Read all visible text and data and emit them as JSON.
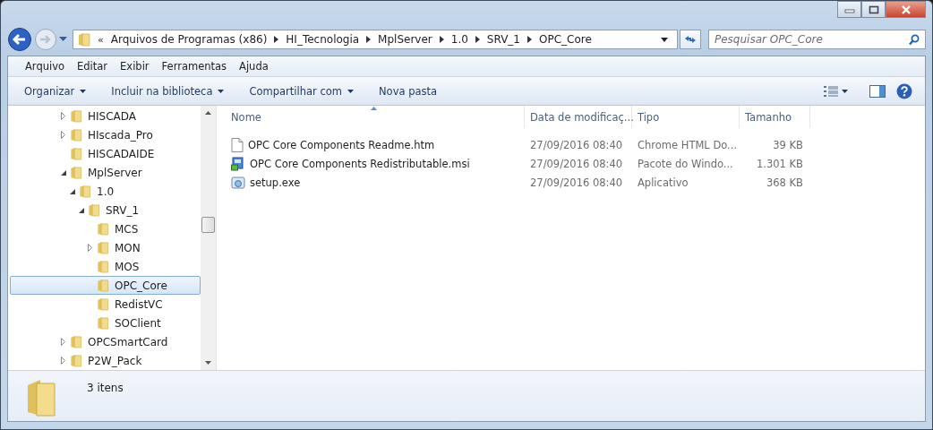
{
  "address_bar": {
    "overflow": "«",
    "path": [
      "Arquivos de Programas (x86)",
      "HI_Tecnologia",
      "MplServer",
      "1.0",
      "SRV_1",
      "OPC_Core"
    ]
  },
  "search": {
    "placeholder": "Pesquisar OPC_Core"
  },
  "menu": [
    "Arquivo",
    "Editar",
    "Exibir",
    "Ferramentas",
    "Ajuda"
  ],
  "commands": [
    {
      "label": "Organizar",
      "dropdown": true
    },
    {
      "label": "Incluir na biblioteca",
      "dropdown": true
    },
    {
      "label": "Compartilhar com",
      "dropdown": true
    },
    {
      "label": "Nova pasta",
      "dropdown": false
    }
  ],
  "tree": [
    {
      "label": "HISCADA",
      "kind": "collapsed",
      "selected": false
    },
    {
      "label": "HIscada_Pro",
      "kind": "collapsed",
      "selected": false
    },
    {
      "label": "HISCADAIDE",
      "kind": "leaf",
      "selected": false
    },
    {
      "label": "MplServer",
      "kind": "expanded",
      "selected": false,
      "children": [
        {
          "label": "1.0",
          "kind": "expanded",
          "selected": false,
          "children": [
            {
              "label": "SRV_1",
              "kind": "expanded",
              "selected": false,
              "children": [
                {
                  "label": "MCS",
                  "kind": "leaf",
                  "selected": false
                },
                {
                  "label": "MON",
                  "kind": "collapsed",
                  "selected": false
                },
                {
                  "label": "MOS",
                  "kind": "leaf",
                  "selected": false
                },
                {
                  "label": "OPC_Core",
                  "kind": "leaf",
                  "selected": true
                },
                {
                  "label": "RedistVC",
                  "kind": "leaf",
                  "selected": false
                },
                {
                  "label": "SOClient",
                  "kind": "leaf",
                  "selected": false
                }
              ]
            }
          ]
        }
      ]
    },
    {
      "label": "OPCSmartCard",
      "kind": "collapsed",
      "selected": false
    },
    {
      "label": "P2W_Pack",
      "kind": "collapsed",
      "selected": false
    }
  ],
  "table": {
    "columns": [
      "Nome",
      "Data de modificaç...",
      "Tipo",
      "Tamanho"
    ],
    "rows": [
      {
        "kind": "document",
        "name": "OPC Core Components Readme.htm",
        "date": "27/09/2016 08:40",
        "type": "Chrome HTML Do...",
        "size": "39 KB"
      },
      {
        "kind": "installer",
        "name": "OPC Core Components Redistributable.msi",
        "date": "27/09/2016 08:40",
        "type": "Pacote do Windo...",
        "size": "1.301 KB"
      },
      {
        "kind": "application",
        "name": "setup.exe",
        "date": "27/09/2016 08:40",
        "type": "Aplicativo",
        "size": "368 KB"
      }
    ]
  },
  "status_bar": {
    "count": "3 itens"
  }
}
